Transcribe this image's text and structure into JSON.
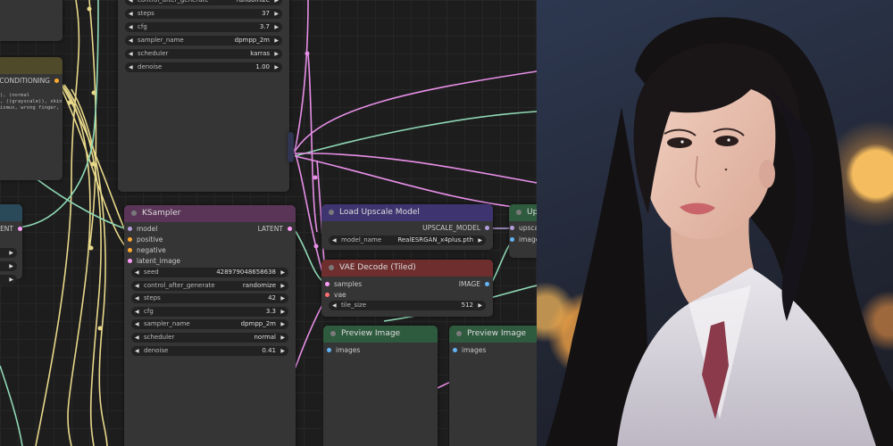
{
  "colors": {
    "canvas_bg": "#1d1d1d",
    "node_bg": "#353535",
    "wire_model": "#b39ddb",
    "wire_clip": "#f0e68c",
    "wire_conditioning": "#ffa931",
    "wire_latent": "#ff9cf9",
    "wire_vae": "#ff6e6e",
    "wire_image": "#64b5f6",
    "wire_green": "#8fd9b6",
    "wire_pink": "#e78fe7",
    "wire_yellow": "#e8d88a"
  },
  "top_sampler": {
    "widgets": [
      {
        "name": "control_after_generate",
        "value": "randomize"
      },
      {
        "name": "steps",
        "value": "37"
      },
      {
        "name": "cfg",
        "value": "3.7"
      },
      {
        "name": "sampler_name",
        "value": "dpmpp_2m"
      },
      {
        "name": "scheduler",
        "value": "karras"
      },
      {
        "name": "denoise",
        "value": "1.00"
      }
    ]
  },
  "conditioning_node": {
    "output": "CONDITIONING",
    "text": "), (normal\n, ((grayscale)), skin\nismus, wrong finger,"
  },
  "left_latent_node": {
    "output": "ATENT"
  },
  "ksampler": {
    "title": "KSampler",
    "inputs": [
      "model",
      "positive",
      "negative",
      "latent_image"
    ],
    "output": "LATENT",
    "widgets": [
      {
        "name": "seed",
        "value": "428979048658638"
      },
      {
        "name": "control_after_generate",
        "value": "randomize"
      },
      {
        "name": "steps",
        "value": "42"
      },
      {
        "name": "cfg",
        "value": "3.3"
      },
      {
        "name": "sampler_name",
        "value": "dpmpp_2m"
      },
      {
        "name": "scheduler",
        "value": "normal"
      },
      {
        "name": "denoise",
        "value": "0.41"
      }
    ]
  },
  "load_upscale": {
    "title": "Load Upscale Model",
    "output": "UPSCALE_MODEL",
    "widget": {
      "name": "model_name",
      "value": "RealESRGAN_x4plus.pth"
    }
  },
  "vae_decode": {
    "title": "VAE Decode (Tiled)",
    "inputs": [
      "samples",
      "vae"
    ],
    "output": "IMAGE",
    "widget": {
      "name": "tile_size",
      "value": "512"
    }
  },
  "upscale_node": {
    "title": "Ups",
    "inputs": [
      "upscale",
      "image"
    ]
  },
  "preview1": {
    "title": "Preview Image",
    "input": "images"
  },
  "preview2": {
    "title": "Preview Image",
    "input": "images"
  }
}
